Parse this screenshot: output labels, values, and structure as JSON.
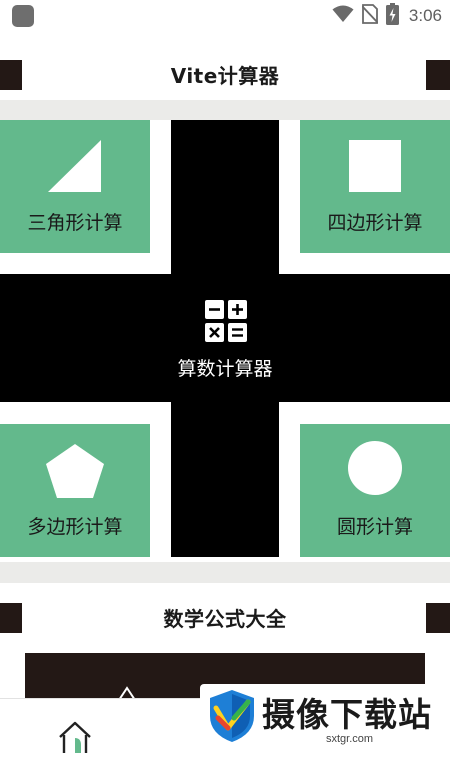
{
  "status_bar": {
    "time": "3:06",
    "icons": [
      "app-icon",
      "wifi-icon",
      "no-sim-icon",
      "battery-charging-icon"
    ]
  },
  "header": {
    "title": "Vite计算器"
  },
  "tiles": {
    "triangle": {
      "label": "三角形计算",
      "icon": "triangle-icon"
    },
    "quadrilateral": {
      "label": "四边形计算",
      "icon": "square-icon"
    },
    "polygon": {
      "label": "多边形计算",
      "icon": "pentagon-icon"
    },
    "circle": {
      "label": "圆形计算",
      "icon": "circle-icon"
    }
  },
  "center": {
    "label": "算数计算器",
    "icon": "calculator-icon"
  },
  "formulas": {
    "title": "数学公式大全"
  },
  "bottom_nav": {
    "items": [
      {
        "icon": "home-icon"
      }
    ]
  },
  "watermark": {
    "text": "摄像下载站",
    "url": "sxtgr.com"
  },
  "colors": {
    "tile_green": "#63b98c",
    "cross_black": "#000000",
    "accent_dark": "#231815",
    "band_gray": "#ebebe9"
  }
}
